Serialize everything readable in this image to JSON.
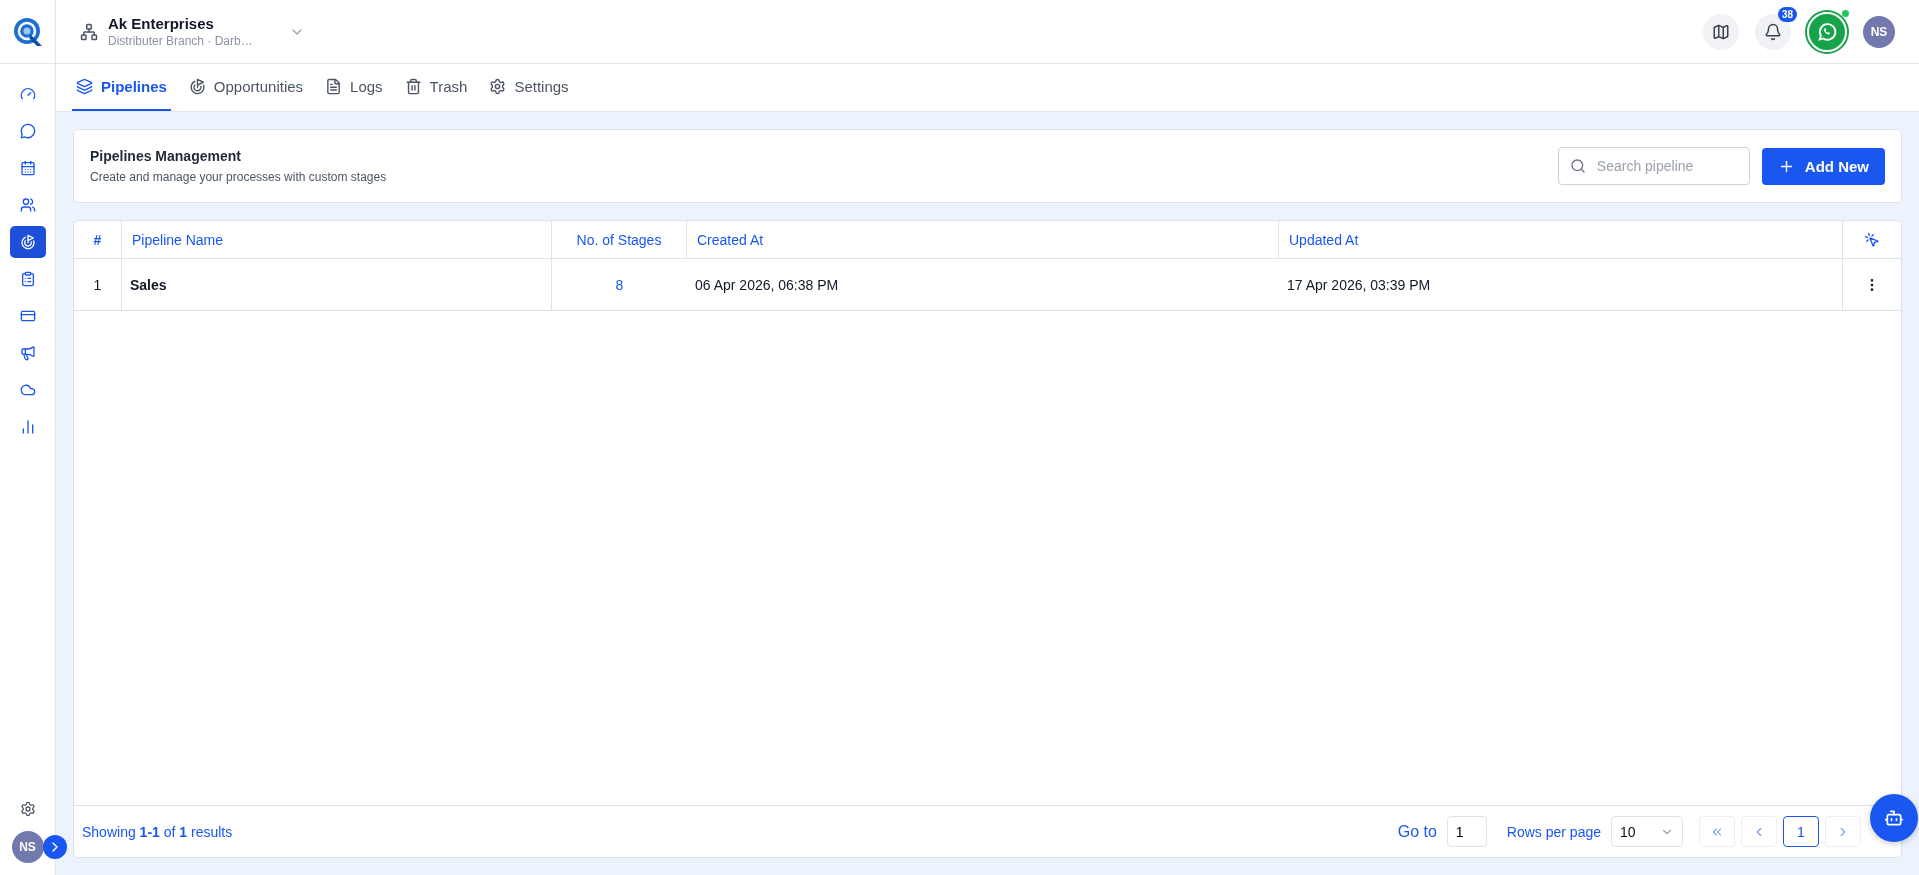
{
  "org": {
    "name": "Ak Enterprises",
    "branch": "Distributer Branch · Darb…"
  },
  "header": {
    "notification_count": "38",
    "whatsapp_online": true,
    "user_initials": "NS"
  },
  "sidebar": {
    "items": [
      {
        "selected": false
      },
      {
        "selected": false
      },
      {
        "selected": false
      },
      {
        "selected": false
      },
      {
        "selected": true
      },
      {
        "selected": false
      },
      {
        "selected": false
      },
      {
        "selected": false
      },
      {
        "selected": false
      },
      {
        "selected": false
      }
    ],
    "user_initials": "NS"
  },
  "tabs": [
    {
      "label": "Pipelines",
      "selected": true
    },
    {
      "label": "Opportunities",
      "selected": false
    },
    {
      "label": "Logs",
      "selected": false
    },
    {
      "label": "Trash",
      "selected": false
    },
    {
      "label": "Settings",
      "selected": false
    }
  ],
  "panel": {
    "title": "Pipelines Management",
    "subtitle": "Create and manage your processes with custom stages",
    "search": {
      "placeholder": "Search pipeline"
    },
    "add_button": "Add New"
  },
  "table": {
    "columns": [
      "#",
      "Pipeline Name",
      "No. of Stages",
      "Created At",
      "Updated At"
    ],
    "rows": [
      {
        "index": "1",
        "name": "Sales",
        "stages": "8",
        "created": "06 Apr 2026, 06:38 PM",
        "updated": "17 Apr 2026, 03:39 PM"
      }
    ]
  },
  "footer": {
    "summary": "Showing **1-1** of **1** results",
    "goto_label": "Go to",
    "goto_value": "1",
    "rows_label": "Rows per page",
    "rows_value": "10",
    "pages": [
      {
        "label": "1",
        "selected": true
      }
    ]
  }
}
